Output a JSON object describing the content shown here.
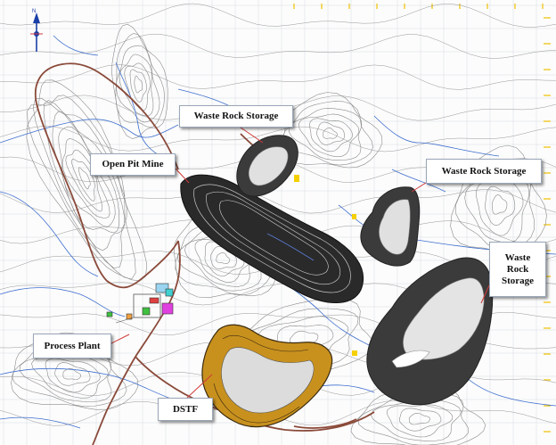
{
  "map": {
    "labels": {
      "waste_rock_storage_north": "Waste Rock Storage",
      "waste_rock_storage_east": "Waste Rock Storage",
      "waste_rock_storage_southeast_line1": "Waste",
      "waste_rock_storage_southeast_line2": "Rock",
      "waste_rock_storage_southeast_line3": "Storage",
      "open_pit_mine": "Open Pit Mine",
      "process_plant": "Process Plant",
      "dstf": "DSTF"
    },
    "north_arrow": {
      "label": "N",
      "icon": "north-arrow-icon"
    },
    "colors": {
      "background": "#fcfcfc",
      "grid": "#e3e6ea",
      "contour": "#8b8b8b",
      "stream": "#3f6fcf",
      "road": "#8a4a3a",
      "waste_rock_fill": "#3b3b3b",
      "waste_rock_core": "#e0e0e0",
      "dstf_fill": "#c8911e",
      "dstf_core": "#dcdcdc",
      "pit_fill": "#2a2a2a",
      "leader": "#d33a3a",
      "grid_tick": "#f0c000"
    }
  }
}
